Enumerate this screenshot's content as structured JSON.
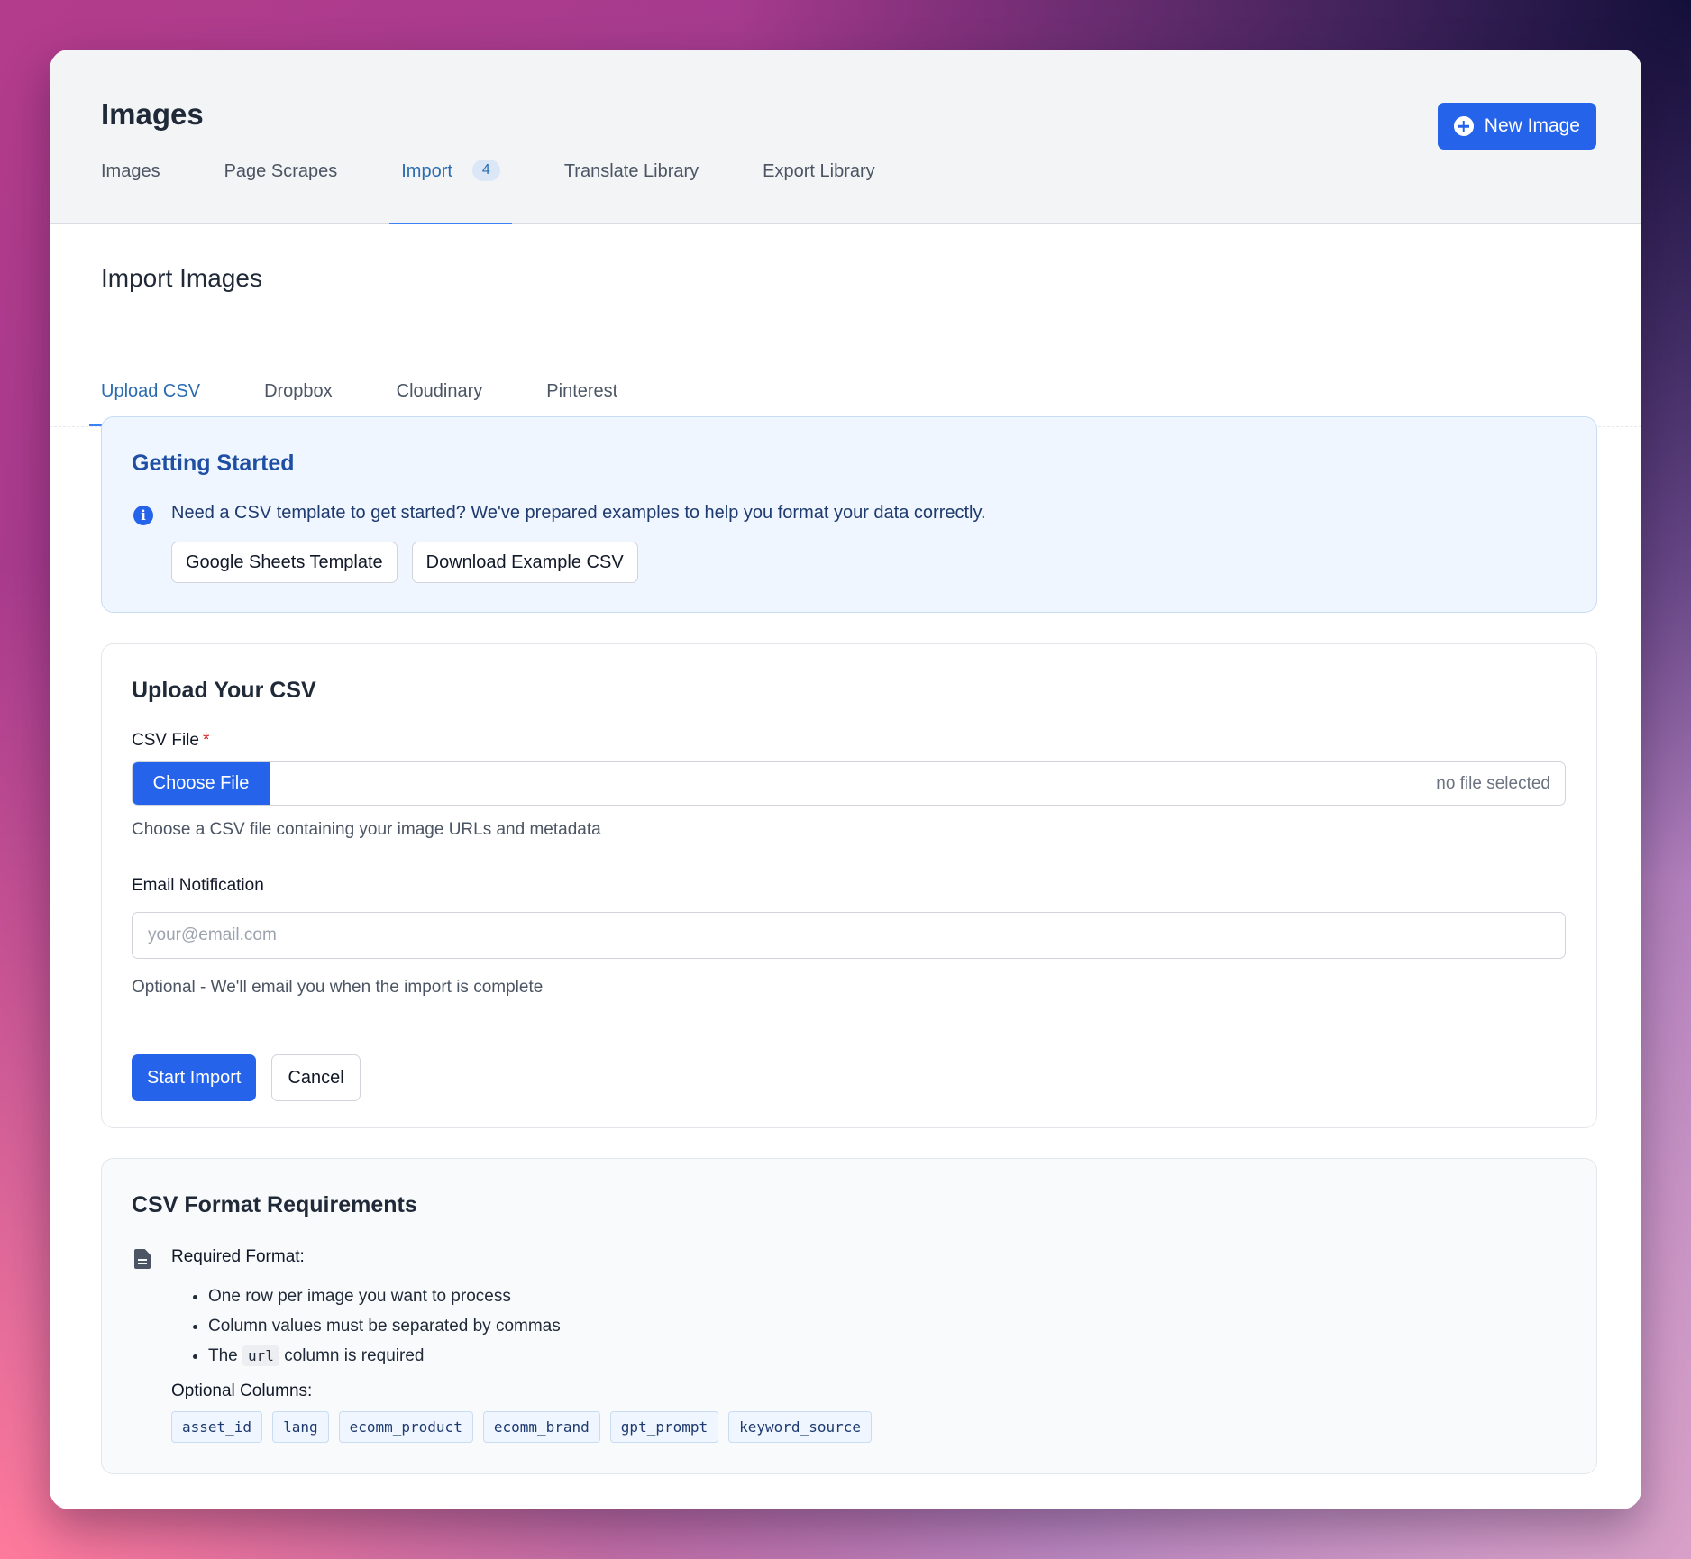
{
  "header": {
    "title": "Images",
    "new_button_label": "New Image",
    "tabs": [
      {
        "label": "Images"
      },
      {
        "label": "Page Scrapes"
      },
      {
        "label": "Import",
        "badge": "4",
        "active": true
      },
      {
        "label": "Translate Library"
      },
      {
        "label": "Export Library"
      }
    ]
  },
  "import": {
    "title": "Import Images",
    "sub_tabs": [
      {
        "label": "Upload CSV",
        "active": true
      },
      {
        "label": "Dropbox"
      },
      {
        "label": "Cloudinary"
      },
      {
        "label": "Pinterest"
      }
    ]
  },
  "getting_started": {
    "title": "Getting Started",
    "text": "Need a CSV template to get started? We've prepared examples to help you format your data correctly.",
    "buttons": [
      "Google Sheets Template",
      "Download Example CSV"
    ]
  },
  "upload": {
    "title": "Upload Your CSV",
    "csv_label": "CSV File",
    "required_mark": "*",
    "choose_file_label": "Choose File",
    "no_file_text": "no file selected",
    "csv_help": "Choose a CSV file containing your image URLs and metadata",
    "email_label": "Email Notification",
    "email_value": "",
    "email_placeholder": "your@email.com",
    "email_help": "Optional - We'll email you when the import is complete",
    "start_label": "Start Import",
    "cancel_label": "Cancel"
  },
  "requirements": {
    "title": "CSV Format Requirements",
    "required_format_label": "Required Format:",
    "rules": [
      "One row per image you want to process",
      "Column values must be separated by commas"
    ],
    "url_rule": {
      "prefix": "The",
      "code": "url",
      "suffix": "column is required"
    },
    "optional_label": "Optional Columns:",
    "optional_columns": [
      "asset_id",
      "lang",
      "ecomm_product",
      "ecomm_brand",
      "gpt_prompt",
      "keyword_source"
    ]
  },
  "icons": {
    "new_button": "plus-circle-icon",
    "info": "info-icon",
    "document": "document-icon"
  },
  "colors": {
    "accent": "#2563eb",
    "active_tab": "#2b6cb0",
    "info_bg": "#eff6ff"
  }
}
